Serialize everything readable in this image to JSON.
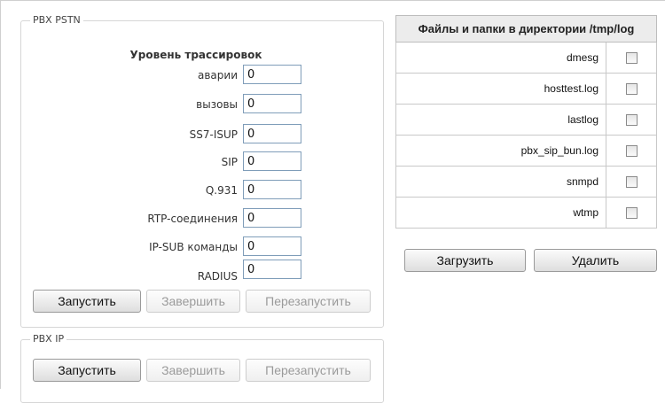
{
  "pbx_pstn": {
    "legend": "PBX PSTN",
    "trace_title": "Уровень трассировок",
    "rows": [
      {
        "label": "аварии",
        "value": "0"
      },
      {
        "label": "вызовы",
        "value": "0"
      },
      {
        "label": "SS7-ISUP",
        "value": "0"
      },
      {
        "label": "SIP",
        "value": "0"
      },
      {
        "label": "Q.931",
        "value": "0"
      },
      {
        "label": "RTP-соединения",
        "value": "0"
      },
      {
        "label": "IP-SUB команды",
        "value": "0"
      },
      {
        "label": "RADIUS",
        "value": "0"
      }
    ],
    "buttons": {
      "start": "Запустить",
      "stop": "Завершить",
      "restart": "Перезапустить"
    }
  },
  "pbx_ip": {
    "legend": "PBX IP",
    "buttons": {
      "start": "Запустить",
      "stop": "Завершить",
      "restart": "Перезапустить"
    }
  },
  "files_panel": {
    "header": "Файлы и папки в директории /tmp/log",
    "files": [
      {
        "name": "dmesg",
        "checked": false
      },
      {
        "name": "hosttest.log",
        "checked": false
      },
      {
        "name": "lastlog",
        "checked": false
      },
      {
        "name": "pbx_sip_bun.log",
        "checked": false
      },
      {
        "name": "snmpd",
        "checked": false
      },
      {
        "name": "wtmp",
        "checked": false
      }
    ],
    "buttons": {
      "download": "Загрузить",
      "delete": "Удалить"
    }
  }
}
